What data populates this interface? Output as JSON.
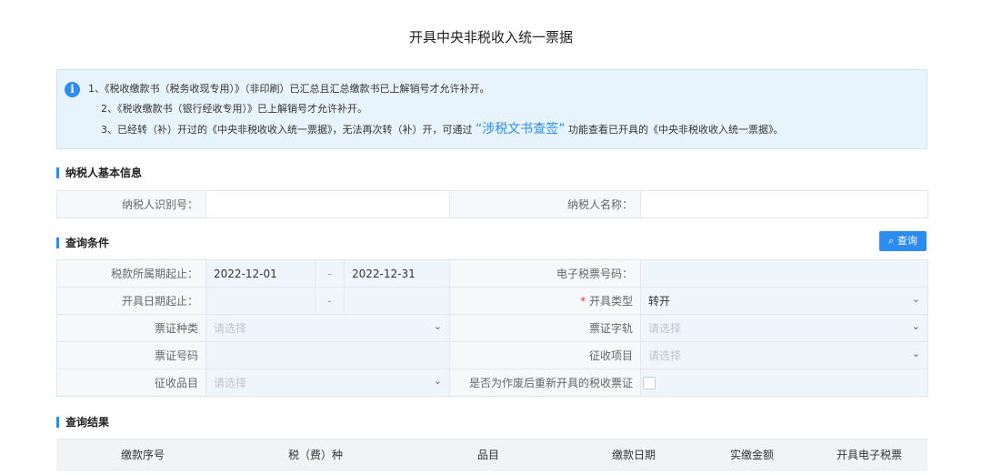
{
  "page": {
    "title": "开具中央非税收入统一票据"
  },
  "notice": {
    "line1": "1、《税收缴款书（税务收现专用）》（非印刷）已汇总且汇总缴款书已上解销号才允许补开。",
    "line2": "2、《税收缴款书（银行经收专用）》已上解销号才允许补开。",
    "line3_pre": "3、已经转（补）开过的《中央非税收收入统一票据》，无法再次转（补）开，可通过",
    "line3_link": "“涉税文书查签”",
    "line3_post": "功能查看已开具的《中央非税收收入统一票据》。"
  },
  "taxpayer": {
    "section_title": "纳税人基本信息",
    "id_label": "纳税人识别号：",
    "id_value": "",
    "name_label": "纳税人名称：",
    "name_value": ""
  },
  "query": {
    "section_title": "查询条件",
    "button_label": "查询",
    "period_label": "税款所属期起止：",
    "period_start": "2022-12-01",
    "period_sep": "-",
    "period_end": "2022-12-31",
    "eticket_label": "电子税票号码：",
    "eticket_value": "",
    "issue_date_label": "开具日期起止：",
    "issue_date_sep": "-",
    "issue_type_required": "*",
    "issue_type_label": "开具类型",
    "issue_type_value": "转开",
    "ticket_kind_label": "票证种类",
    "ticket_kind_placeholder": "请选择",
    "ticket_track_label": "票证字轨",
    "ticket_track_placeholder": "请选择",
    "ticket_no_label": "票证号码",
    "collect_item_label": "征收项目",
    "collect_item_placeholder": "请选择",
    "collect_product_label": "征收品目",
    "collect_product_placeholder": "请选择",
    "reissue_label": "是否为作废后重新开具的税收票证"
  },
  "results": {
    "section_title": "查询结果",
    "columns": [
      "缴款序号",
      "税（费）种",
      "品目",
      "缴款日期",
      "实缴金额",
      "开具电子税票"
    ]
  },
  "colors": {
    "accent": "#2d8cf0",
    "required": "#e4393c"
  }
}
